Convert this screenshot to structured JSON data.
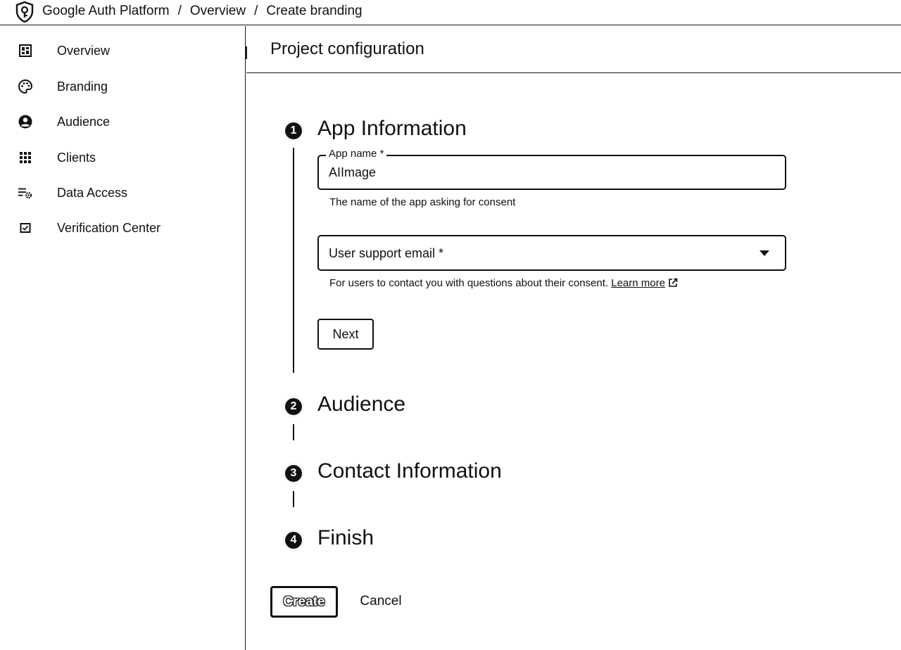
{
  "header": {
    "logo_icon": "shield-keyhole-icon",
    "breadcrumb": [
      "Google Auth Platform",
      "Overview",
      "Create branding"
    ],
    "separator": "/"
  },
  "sidebar": {
    "items": [
      {
        "label": "Overview",
        "icon": "dashboard-icon"
      },
      {
        "label": "Branding",
        "icon": "palette-icon"
      },
      {
        "label": "Audience",
        "icon": "account-circle-icon"
      },
      {
        "label": "Clients",
        "icon": "apps-grid-icon"
      },
      {
        "label": "Data Access",
        "icon": "list-settings-icon"
      },
      {
        "label": "Verification Center",
        "icon": "checkbox-icon"
      }
    ]
  },
  "main": {
    "title": "Project configuration",
    "steps": [
      {
        "number": "1",
        "title": "App Information"
      },
      {
        "number": "2",
        "title": "Audience"
      },
      {
        "number": "3",
        "title": "Contact Information"
      },
      {
        "number": "4",
        "title": "Finish"
      }
    ],
    "app_name": {
      "label": "App name *",
      "value": "AIImage",
      "helper": "The name of the app asking for consent"
    },
    "support_email": {
      "label": "User support email *",
      "helper": "For users to contact you with questions about their consent.",
      "learn_more": "Learn more",
      "dropdown_icon": "arrow-drop-down-icon"
    },
    "next_label": "Next",
    "create_label": "Create",
    "cancel_label": "Cancel"
  }
}
